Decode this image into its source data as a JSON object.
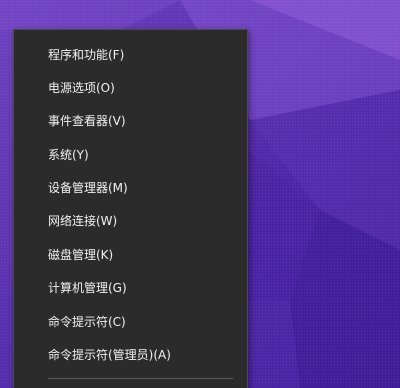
{
  "desktop": {
    "wallpaper_colors": [
      "#6a3fc0",
      "#4a22a8",
      "#3b1a98"
    ]
  },
  "context_menu": {
    "background": "#2b2b2b",
    "text_color": "#f2f2f2",
    "items": [
      {
        "label": "程序和功能(F)"
      },
      {
        "label": "电源选项(O)"
      },
      {
        "label": "事件查看器(V)"
      },
      {
        "label": "系统(Y)"
      },
      {
        "label": "设备管理器(M)"
      },
      {
        "label": "网络连接(W)"
      },
      {
        "label": "磁盘管理(K)"
      },
      {
        "label": "计算机管理(G)"
      },
      {
        "label": "命令提示符(C)"
      },
      {
        "label": "命令提示符(管理员)(A)"
      }
    ]
  }
}
